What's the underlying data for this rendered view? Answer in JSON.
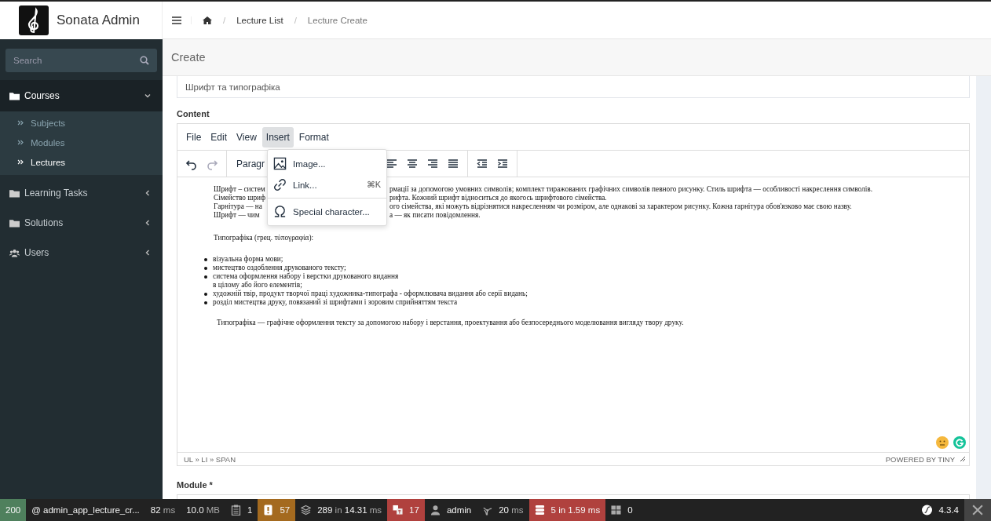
{
  "brand": {
    "name": "Sonata Admin"
  },
  "breadcrumb": [
    {
      "separator": "/",
      "label": "Lecture List",
      "current": false
    },
    {
      "separator": "/",
      "label": "Lecture Create",
      "current": true
    }
  ],
  "sidebar": {
    "search": {
      "placeholder": "Search"
    },
    "items": [
      {
        "label": "Courses",
        "expanded": true,
        "children": [
          {
            "label": "Subjects",
            "selected": false
          },
          {
            "label": "Modules",
            "selected": false
          },
          {
            "label": "Lectures",
            "selected": true
          }
        ]
      },
      {
        "label": "Learning Tasks",
        "expanded": false
      },
      {
        "label": "Solutions",
        "expanded": false
      },
      {
        "label": "Users",
        "expanded": false
      }
    ]
  },
  "page_title": "Create",
  "title_field": {
    "value": "Шрифт та типографіка"
  },
  "content_label": "Content",
  "editor": {
    "menubar": [
      {
        "label": "File",
        "selected": false
      },
      {
        "label": "Edit",
        "selected": false
      },
      {
        "label": "View",
        "selected": false
      },
      {
        "label": "Insert",
        "selected": true
      },
      {
        "label": "Format",
        "selected": false
      }
    ],
    "block_format": "Paragr",
    "insert_menu": [
      {
        "label": "Image..."
      },
      {
        "label": "Link...",
        "shortcut": "⌘K"
      },
      {
        "label": "Special character..."
      }
    ],
    "lines": [
      {
        "left": "Шрифт – систем",
        "right": "рмації за допомогою умовних символів; комплект тиражованих графічних символів певного рисунку. Стиль шрифта — особливості накреслення символів."
      },
      {
        "left": "Сімейство шриф",
        "right": "рифта. Кожний шрифт відноситься до якогось шрифтового сімейства."
      },
      {
        "left": "Гарнітура — на",
        "right": "ого сімейства, які можуть відрізнятися накресленням чи розміром, але однакові за характером рисунку. Кожна гарнітура обов'язково має свою назву."
      },
      {
        "left": "Шрифт — чим",
        "right": "а — як писати повідомлення."
      }
    ],
    "intro": "Типографіка (грец. τύπογραφία):",
    "bullets": [
      "візуальна форма мови;",
      "мистецтво оздоблення друкованого тексту;",
      "система оформлення набору і верстки друкованого видання\nв цілому або його елементів;",
      "художній твір, продукт творчої праці художника-типографа - оформлювача видання або серії видань;",
      "розділ мистецтва друку, повязаний зі шрифтами і зоровим сприйняттям текста"
    ],
    "closing": "Типографіка — графічне оформлення тексту за допомогою набору і верстання, проектування або безпосереднього моделювання вигляду твору друку.",
    "path": "UL » LI » SPAN",
    "powered": "POWERED BY TINY"
  },
  "module_label": "Module *",
  "debug_toolbar": {
    "items": [
      {
        "kind": "status",
        "parts": [
          "200"
        ],
        "color": "#4f805d"
      },
      {
        "kind": "route",
        "parts": [
          "@ admin_app_lecture_cr..."
        ]
      },
      {
        "kind": "time",
        "parts": [
          "82",
          "ms"
        ]
      },
      {
        "kind": "memory",
        "parts": [
          "10.0",
          "MB"
        ]
      },
      {
        "kind": "logs",
        "parts": [
          "1"
        ]
      },
      {
        "kind": "forms",
        "parts": [
          "57"
        ],
        "color": "#a46a1f"
      },
      {
        "kind": "twig",
        "parts": [
          "289",
          "in",
          "14.31",
          "ms"
        ]
      },
      {
        "kind": "translation",
        "parts": [
          "17"
        ],
        "color": "#b0413e"
      },
      {
        "kind": "user",
        "parts": [
          "admin"
        ]
      },
      {
        "kind": "performance",
        "parts": [
          "20",
          "ms"
        ]
      },
      {
        "kind": "database",
        "parts": [
          "5 in 1.59 ms"
        ],
        "color": "#b0413e"
      },
      {
        "kind": "layout",
        "parts": [
          "0"
        ]
      }
    ],
    "version": "4.3.4"
  }
}
